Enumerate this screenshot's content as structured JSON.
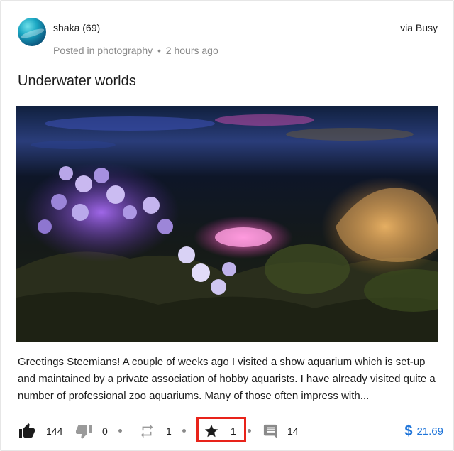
{
  "post": {
    "author": "shaka (69)",
    "posted_in_prefix": "Posted in",
    "category": "photography",
    "separator": "•",
    "time_ago": "2 hours ago",
    "via": "via Busy",
    "title": "Underwater worlds",
    "body": "Greetings Steemians! A couple of weeks ago I visited a show aquarium which is set-up and maintained by a private association of hobby aquarists. I have already visited quite a number of professional zoo aquariums. Many of those often impress with..."
  },
  "footer": {
    "upvotes": "144",
    "downvotes": "0",
    "reblogs": "1",
    "favorites": "1",
    "comments": "14",
    "payout_symbol": "$",
    "payout": "21.69"
  },
  "colors": {
    "accent": "#1e74d9",
    "highlight": "#e8231a",
    "muted": "#8a8a8a"
  },
  "icons": {
    "upvote": "thumbs-up-icon",
    "downvote": "thumbs-down-icon",
    "reblog": "reblog-icon",
    "favorite": "star-icon",
    "comments": "comment-icon",
    "payout": "dollar-icon"
  }
}
